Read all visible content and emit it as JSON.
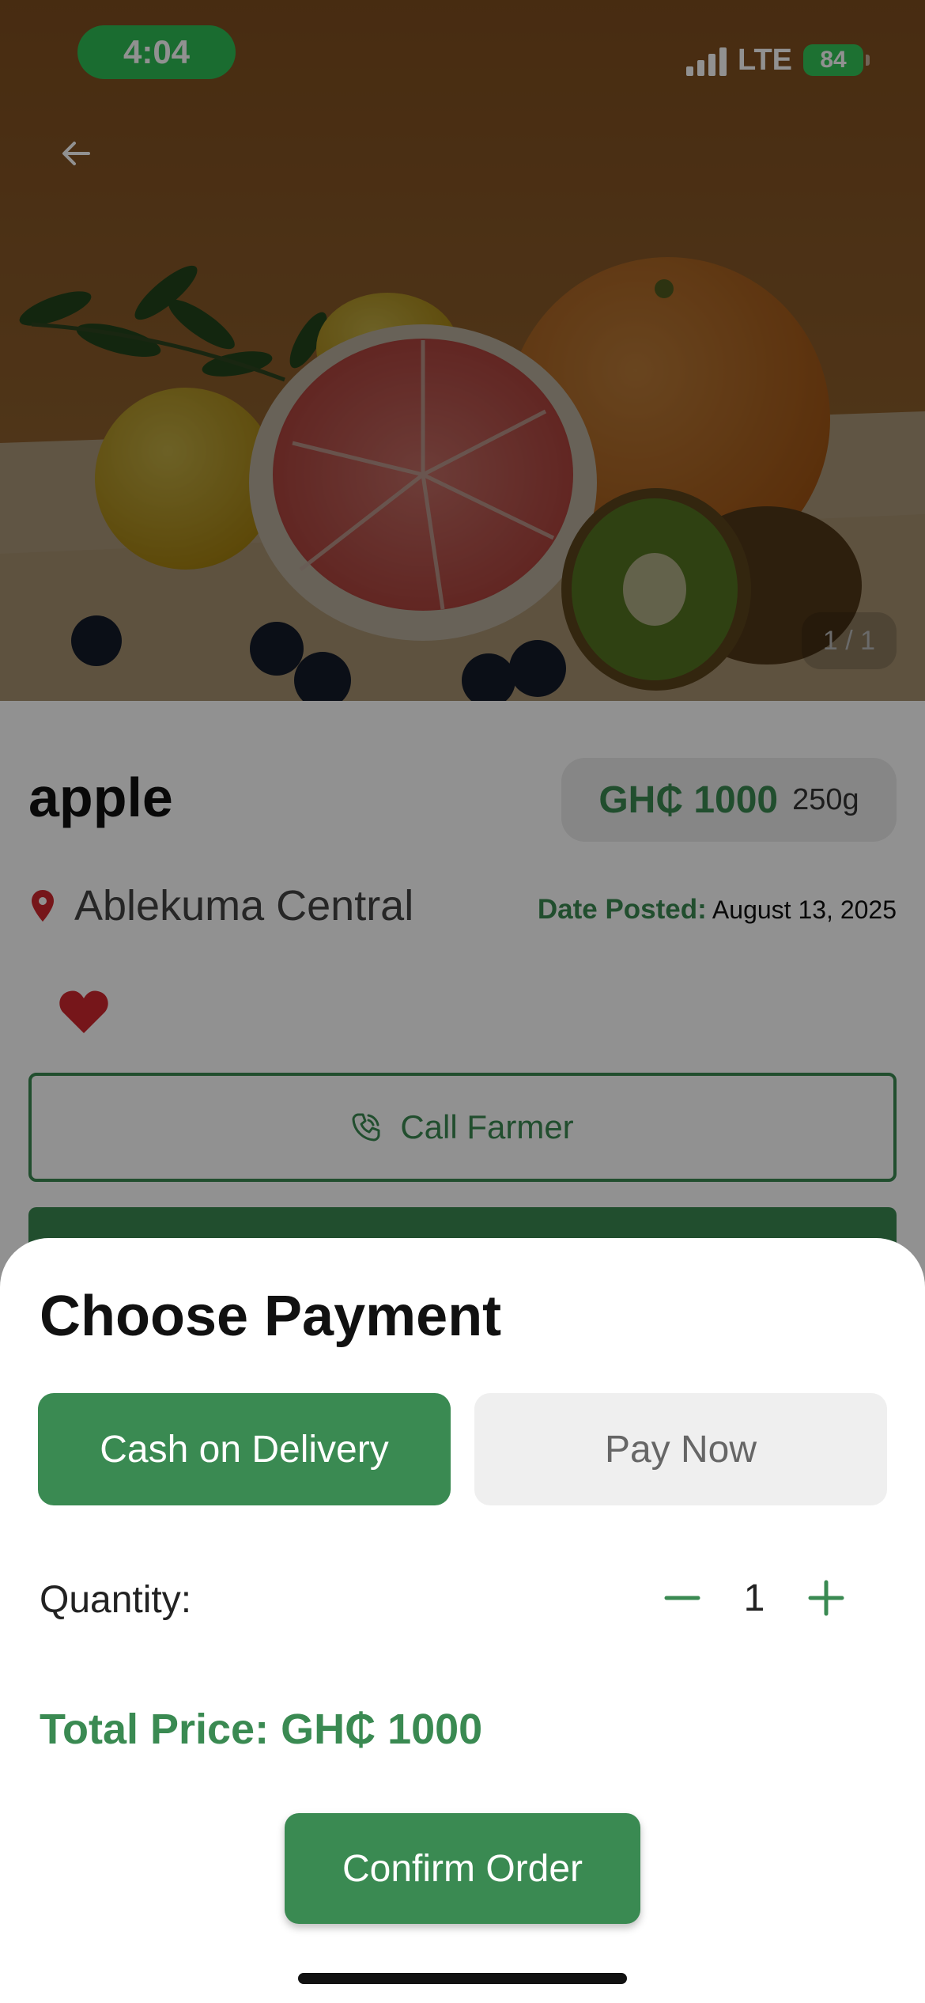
{
  "status_bar": {
    "time": "4:04",
    "network": "LTE",
    "battery": "84"
  },
  "image_counter": "1 / 1",
  "product": {
    "name": "apple",
    "price": "GH₵ 1000",
    "weight": "250g",
    "location": "Ablekuma Central",
    "date_label": "Date Posted:",
    "date_value": "August 13, 2025",
    "call_label": "Call Farmer"
  },
  "payment_sheet": {
    "title": "Choose Payment",
    "options": [
      "Cash on Delivery",
      "Pay Now"
    ],
    "selected_option": "Cash on Delivery",
    "quantity_label": "Quantity:",
    "quantity": "1",
    "total_price": "Total Price: GH₵ 1000",
    "confirm_label": "Confirm Order"
  },
  "icons": {
    "back": "arrow-left-icon",
    "location": "map-pin-icon",
    "favorite": "heart-icon",
    "call": "phone-icon",
    "decrease": "minus-icon",
    "increase": "plus-icon"
  },
  "colors": {
    "accent_green": "#3a8a52",
    "status_green": "#2fbf55",
    "favorite_red": "#d0282e",
    "pin_red": "#d0282e",
    "unselected_option": "#efefef"
  }
}
